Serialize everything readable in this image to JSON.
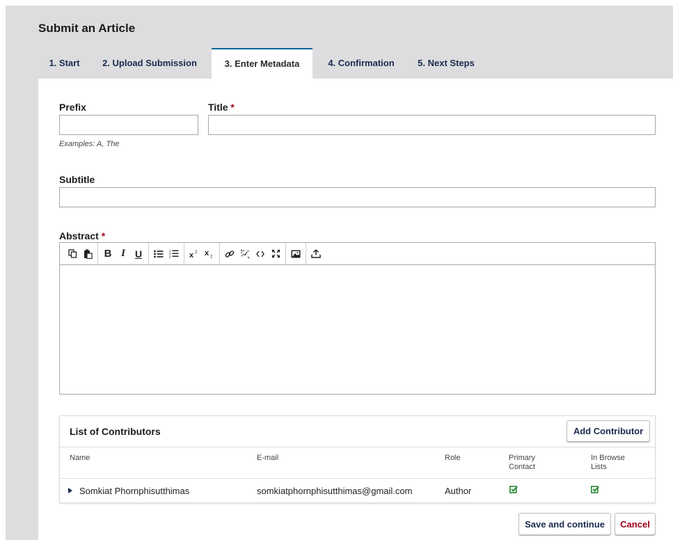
{
  "page": {
    "title": "Submit an Article"
  },
  "tabs": [
    {
      "label": "1. Start"
    },
    {
      "label": "2. Upload Submission"
    },
    {
      "label": "3. Enter Metadata"
    },
    {
      "label": "4. Confirmation"
    },
    {
      "label": "5. Next Steps"
    }
  ],
  "active_tab": 2,
  "form": {
    "prefix": {
      "label": "Prefix",
      "value": "",
      "hint": "Examples: A, The"
    },
    "title": {
      "label": "Title",
      "required": "*",
      "value": ""
    },
    "subtitle": {
      "label": "Subtitle",
      "value": ""
    },
    "abstract": {
      "label": "Abstract",
      "required": "*",
      "value": ""
    }
  },
  "toolbar_icons": [
    [
      "copy-icon",
      "paste-icon"
    ],
    [
      "bold-icon",
      "italic-icon",
      "underline-icon"
    ],
    [
      "bulleted-list-icon",
      "numbered-list-icon"
    ],
    [
      "superscript-icon",
      "subscript-icon"
    ],
    [
      "link-icon",
      "unlink-icon",
      "code-icon",
      "fullscreen-icon"
    ],
    [
      "image-icon"
    ],
    [
      "upload-icon"
    ]
  ],
  "contributors": {
    "title": "List of Contributors",
    "add_button": "Add Contributor",
    "columns": {
      "name": "Name",
      "email": "E-mail",
      "role": "Role",
      "primary_contact": "Primary Contact",
      "in_browse_lists": "In Browse Lists"
    },
    "rows": [
      {
        "name": "Somkiat Phornphisutthimas",
        "email": "somkiatphornphisutthimas@gmail.com",
        "role": "Author",
        "primary_contact": true,
        "in_browse_lists": true
      }
    ]
  },
  "actions": {
    "save": "Save and continue",
    "cancel": "Cancel"
  },
  "colors": {
    "accent": "#006798",
    "required": "#a0001b",
    "cancel": "#a0001b",
    "check": "#1a7f2a",
    "tab_text": "#1b2a4d"
  }
}
